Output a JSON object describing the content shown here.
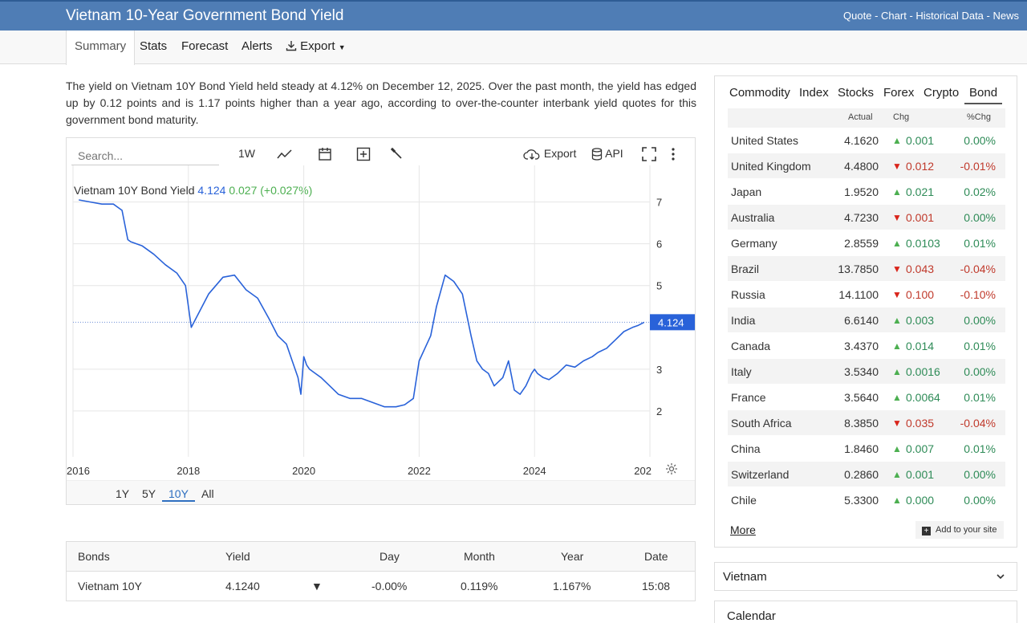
{
  "header": {
    "title": "Vietnam 10-Year Government Bond Yield",
    "links": [
      "Quote",
      "Chart",
      "Historical Data",
      "News"
    ],
    "separator": " - "
  },
  "nav": {
    "tabs": [
      "Summary",
      "Stats",
      "Forecast",
      "Alerts",
      "Export"
    ],
    "active": "Summary"
  },
  "summary_text": "The yield on Vietnam 10Y Bond Yield held steady at 4.12% on December 12, 2025. Over the past month, the yield has edged up by 0.12 points and is 1.17 points higher than a year ago, according to over-the-counter interbank yield quotes for this government bond maturity.",
  "chart_toolbar": {
    "search_placeholder": "Search...",
    "interval": "1W",
    "export_label": "Export",
    "api_label": "API"
  },
  "chart_legend": {
    "name": "Vietnam 10Y Bond Yield",
    "value": "4.124",
    "change": "0.027 (+0.027%)"
  },
  "chart_data": {
    "type": "line",
    "title": "",
    "xlabel": "",
    "ylabel": "",
    "ylim": [
      1.0,
      7.3
    ],
    "xlim": [
      2016.0,
      2026.0
    ],
    "grid": true,
    "y_axis_side": "right",
    "y_ticks": [
      "7",
      "6",
      "5",
      "3",
      "2"
    ],
    "x_ticks": [
      "2016",
      "2018",
      "2020",
      "2022",
      "2024",
      "202"
    ],
    "last_value_label": "4.124",
    "series": [
      {
        "color": "#2962d9",
        "x": [
          2016.1,
          2016.3,
          2016.5,
          2016.7,
          2016.85,
          2016.95,
          2017.0,
          2017.2,
          2017.4,
          2017.6,
          2017.8,
          2017.95,
          2018.05,
          2018.2,
          2018.35,
          2018.6,
          2018.8,
          2019.0,
          2019.2,
          2019.4,
          2019.55,
          2019.7,
          2019.8,
          2019.9,
          2019.95,
          2020.0,
          2020.05,
          2020.1,
          2020.2,
          2020.3,
          2020.45,
          2020.6,
          2020.8,
          2021.0,
          2021.2,
          2021.4,
          2021.6,
          2021.75,
          2021.9,
          2022.0,
          2022.1,
          2022.2,
          2022.3,
          2022.45,
          2022.6,
          2022.75,
          2022.9,
          2023.0,
          2023.1,
          2023.2,
          2023.3,
          2023.45,
          2023.55,
          2023.65,
          2023.75,
          2023.85,
          2023.95,
          2024.0,
          2024.05,
          2024.15,
          2024.25,
          2024.4,
          2024.55,
          2024.7,
          2024.85,
          2025.0,
          2025.1,
          2025.25,
          2025.4,
          2025.55,
          2025.7,
          2025.8,
          2025.9
        ],
        "y": [
          7.05,
          7.0,
          6.95,
          6.95,
          6.8,
          6.1,
          6.05,
          5.95,
          5.75,
          5.5,
          5.3,
          5.0,
          4.0,
          4.4,
          4.8,
          5.2,
          5.25,
          4.9,
          4.7,
          4.2,
          3.8,
          3.6,
          3.2,
          2.8,
          2.4,
          3.3,
          3.1,
          3.0,
          2.9,
          2.8,
          2.6,
          2.4,
          2.3,
          2.3,
          2.2,
          2.1,
          2.1,
          2.15,
          2.3,
          3.2,
          3.5,
          3.8,
          4.5,
          5.25,
          5.1,
          4.8,
          3.8,
          3.2,
          3.0,
          2.9,
          2.6,
          2.8,
          3.2,
          2.5,
          2.4,
          2.6,
          2.9,
          3.0,
          2.9,
          2.8,
          2.75,
          2.9,
          3.1,
          3.05,
          3.2,
          3.3,
          3.4,
          3.5,
          3.7,
          3.9,
          4.0,
          4.05,
          4.124
        ]
      }
    ]
  },
  "range_buttons": [
    "1Y",
    "5Y",
    "10Y",
    "All"
  ],
  "range_active": "10Y",
  "bonds_table": {
    "headers": [
      "Bonds",
      "Yield",
      "Day",
      "Month",
      "Year",
      "Date"
    ],
    "row": {
      "name": "Vietnam 10Y",
      "yield": "4.1240",
      "day": "-0.00%",
      "month": "0.119%",
      "year": "1.167%",
      "date": "15:08"
    }
  },
  "side_tabs": [
    "Commodity",
    "Index",
    "Stocks",
    "Forex",
    "Crypto",
    "Bond"
  ],
  "side_active": "Bond",
  "side_columns": [
    "Actual",
    "Chg",
    "%Chg"
  ],
  "side_rows": [
    {
      "name": "United States",
      "actual": "4.1620",
      "dir": "up",
      "chg": "0.001",
      "pct": "0.00%"
    },
    {
      "name": "United Kingdom",
      "actual": "4.4800",
      "dir": "down",
      "chg": "0.012",
      "pct": "-0.01%"
    },
    {
      "name": "Japan",
      "actual": "1.9520",
      "dir": "up",
      "chg": "0.021",
      "pct": "0.02%"
    },
    {
      "name": "Australia",
      "actual": "4.7230",
      "dir": "down",
      "chg": "0.001",
      "pct": "0.00%"
    },
    {
      "name": "Germany",
      "actual": "2.8559",
      "dir": "up",
      "chg": "0.0103",
      "pct": "0.01%"
    },
    {
      "name": "Brazil",
      "actual": "13.7850",
      "dir": "down",
      "chg": "0.043",
      "pct": "-0.04%"
    },
    {
      "name": "Russia",
      "actual": "14.1100",
      "dir": "down",
      "chg": "0.100",
      "pct": "-0.10%"
    },
    {
      "name": "India",
      "actual": "6.6140",
      "dir": "up",
      "chg": "0.003",
      "pct": "0.00%"
    },
    {
      "name": "Canada",
      "actual": "3.4370",
      "dir": "up",
      "chg": "0.014",
      "pct": "0.01%"
    },
    {
      "name": "Italy",
      "actual": "3.5340",
      "dir": "up",
      "chg": "0.0016",
      "pct": "0.00%"
    },
    {
      "name": "France",
      "actual": "3.5640",
      "dir": "up",
      "chg": "0.0064",
      "pct": "0.01%"
    },
    {
      "name": "South Africa",
      "actual": "8.3850",
      "dir": "down",
      "chg": "0.035",
      "pct": "-0.04%"
    },
    {
      "name": "China",
      "actual": "1.8460",
      "dir": "up",
      "chg": "0.007",
      "pct": "0.01%"
    },
    {
      "name": "Switzerland",
      "actual": "0.2860",
      "dir": "up",
      "chg": "0.001",
      "pct": "0.00%"
    },
    {
      "name": "Chile",
      "actual": "5.3300",
      "dir": "up",
      "chg": "0.000",
      "pct": "0.00%"
    }
  ],
  "side_more": "More",
  "side_add": "Add to your site",
  "accordions": [
    "Vietnam",
    "Calendar"
  ],
  "colors": {
    "header": "#4f7db5",
    "line": "#2962d9",
    "up": "#4caf50",
    "down": "#d9241a",
    "pos_text": "#2e8b57",
    "neg_text": "#c0392b"
  }
}
